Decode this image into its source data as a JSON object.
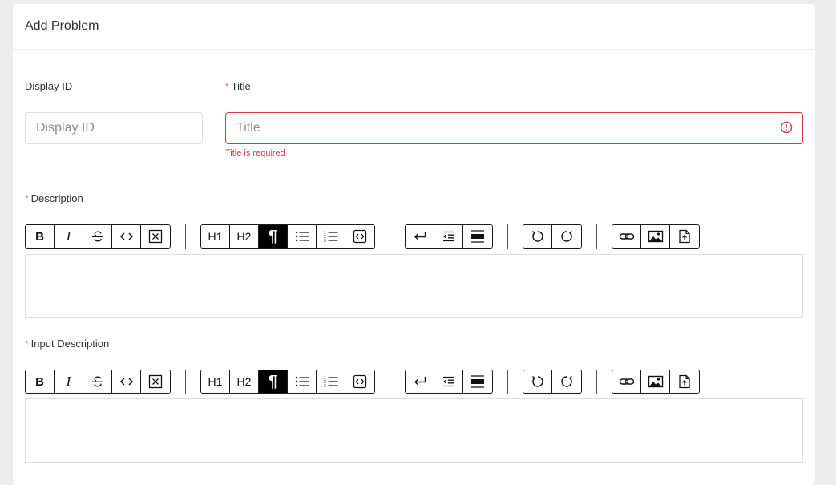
{
  "header": {
    "title": "Add Problem"
  },
  "display_id": {
    "label": "Display ID",
    "placeholder": "Display ID"
  },
  "title_field": {
    "required_mark": "*",
    "label": "Title",
    "placeholder": "Title",
    "error": "Title is required",
    "error_color": "#d03a4e"
  },
  "description": {
    "required_mark": "*",
    "label": "Description"
  },
  "input_description": {
    "required_mark": "*",
    "label": "Input Description"
  },
  "toolbar": {
    "bold": "B",
    "italic": "I",
    "h1": "H1",
    "h2": "H2",
    "paragraph": "¶",
    "icons": [
      "bold-icon",
      "italic-icon",
      "strikethrough-icon",
      "code-icon",
      "clear-format-icon",
      "h1",
      "h2",
      "paragraph-icon",
      "bullet-list-icon",
      "ordered-list-icon",
      "code-block-icon",
      "hard-break-icon",
      "outdent-icon",
      "horizontal-rule-icon",
      "undo-icon",
      "redo-icon",
      "link-icon",
      "image-icon",
      "file-upload-icon"
    ]
  }
}
